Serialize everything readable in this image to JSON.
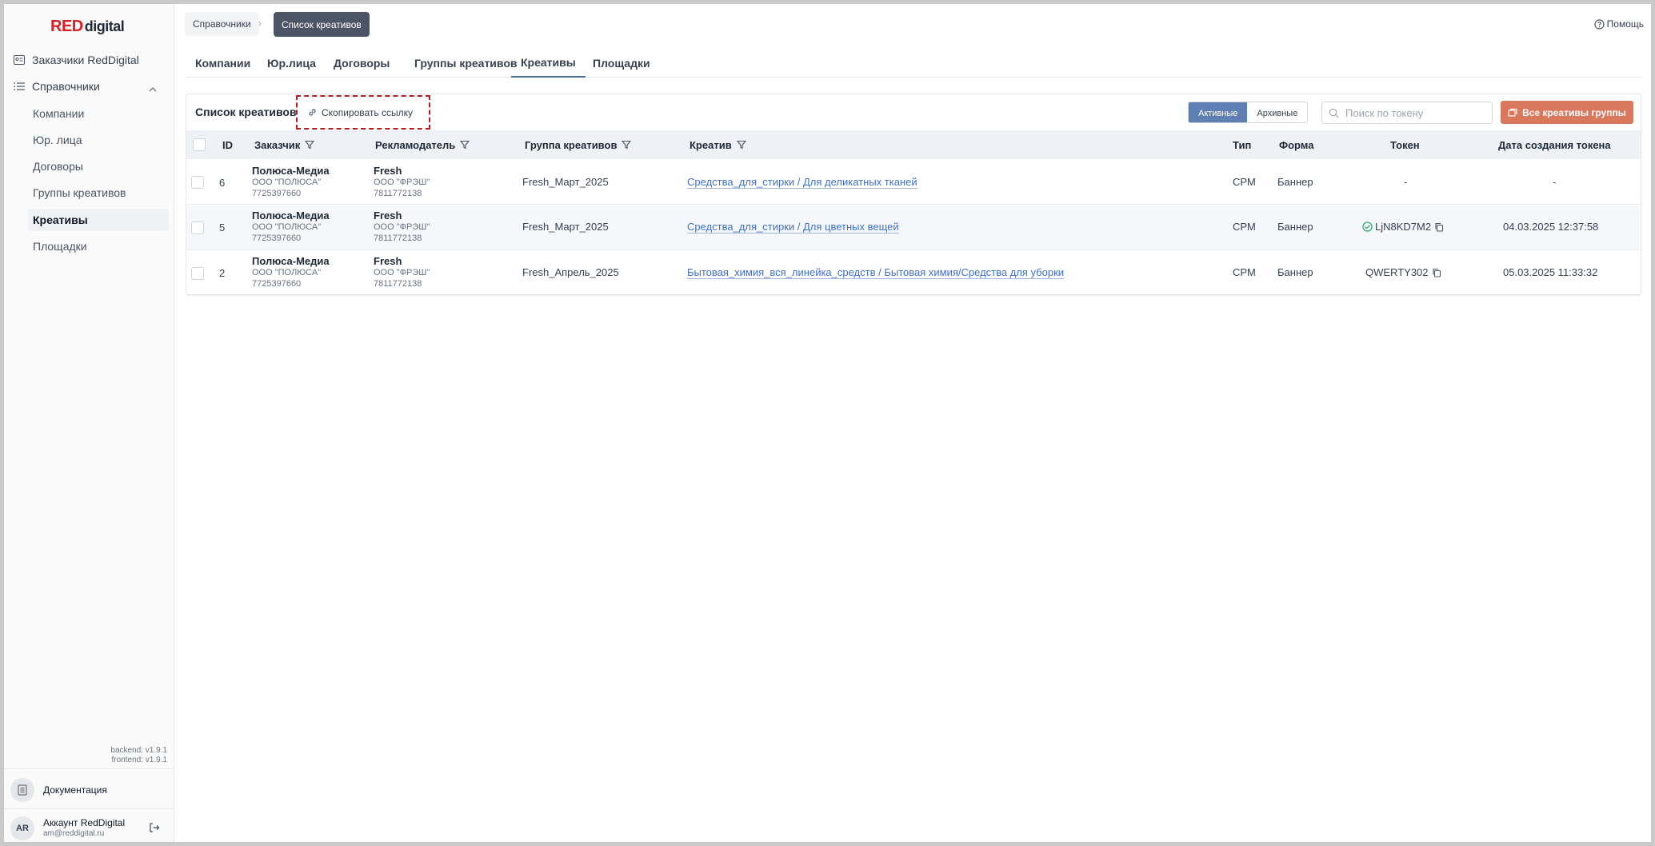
{
  "brand": {
    "logo_red": "RED",
    "logo_rest": "digital"
  },
  "sidebar": {
    "customers": "Заказчики RedDigital",
    "directories": "Справочники",
    "sub_items": [
      "Компании",
      "Юр. лица",
      "Договоры",
      "Группы креативов",
      "Креативы",
      "Площадки"
    ],
    "active_sub": "Креативы",
    "version_backend": "backend: v1.9.1",
    "version_frontend": "frontend: v1.9.1",
    "docs": "Документация",
    "account_initials": "AR",
    "account_name": "Аккаунт RedDigital",
    "account_email": "am@reddigital.ru"
  },
  "breadcrumb": {
    "parent": "Справочники",
    "current": "Список креативов"
  },
  "help": "Помощь",
  "tabs": [
    "Компании",
    "Юр.лица",
    "Договоры",
    "Группы креативов",
    "Креативы",
    "Площадки"
  ],
  "active_tab": "Креативы",
  "panel": {
    "title": "Список креативов",
    "copy_link": "Скопировать ссылку",
    "seg_active": "Активные",
    "seg_archive": "Архивные",
    "search_placeholder": "Поиск по токену",
    "all_groups_button": "Все креативы группы"
  },
  "table": {
    "headers": [
      "ID",
      "Заказчик",
      "Рекламодатель",
      "Группа креативов",
      "Креатив",
      "Тип",
      "Форма",
      "Токен",
      "Дата создания токена"
    ],
    "rows": [
      {
        "id": "6",
        "client": "Полюса-Медиа",
        "client_legal": "ООО \"ПОЛЮСА\"",
        "client_inn": "7725397660",
        "adv": "Fresh",
        "adv_legal": "ООО \"ФРЭШ\"",
        "adv_inn": "7811772138",
        "group": "Fresh_Март_2025",
        "creative": "Средства_для_стирки / Для деликатных тканей",
        "type": "CPM",
        "form": "Баннер",
        "token": "-",
        "token_ok": false,
        "token_copy": false,
        "date": "-"
      },
      {
        "id": "5",
        "client": "Полюса-Медиа",
        "client_legal": "ООО \"ПОЛЮСА\"",
        "client_inn": "7725397660",
        "adv": "Fresh",
        "adv_legal": "ООО \"ФРЭШ\"",
        "adv_inn": "7811772138",
        "group": "Fresh_Март_2025",
        "creative": "Средства_для_стирки / Для цветных вещей",
        "type": "CPM",
        "form": "Баннер",
        "token": "LjN8KD7M2",
        "token_ok": true,
        "token_copy": true,
        "date": "04.03.2025 12:37:58"
      },
      {
        "id": "2",
        "client": "Полюса-Медиа",
        "client_legal": "ООО \"ПОЛЮСА\"",
        "client_inn": "7725397660",
        "adv": "Fresh",
        "adv_legal": "ООО \"ФРЭШ\"",
        "adv_inn": "7811772138",
        "group": "Fresh_Апрель_2025",
        "creative": "Бытовая_химия_вся_линейка_средств / Бытовая химия/Средства для уборки",
        "type": "CPM",
        "form": "Баннер",
        "token": "QWERTY302",
        "token_ok": false,
        "token_copy": true,
        "date": "05.03.2025 11:33:32"
      }
    ]
  },
  "colors": {
    "accent": "#5d7fb3",
    "brand_red": "#d81f26",
    "cta": "#d9785c",
    "link": "#3f72c4",
    "highlight_border": "#b91c1c"
  },
  "icons": {
    "copy_link": "link-icon",
    "search": "search-icon",
    "filter": "filter-icon",
    "token_ok": "check-circle-icon",
    "token_copy": "copy-icon",
    "help": "question-circle-icon",
    "logout": "logout-icon",
    "docs": "document-icon"
  }
}
